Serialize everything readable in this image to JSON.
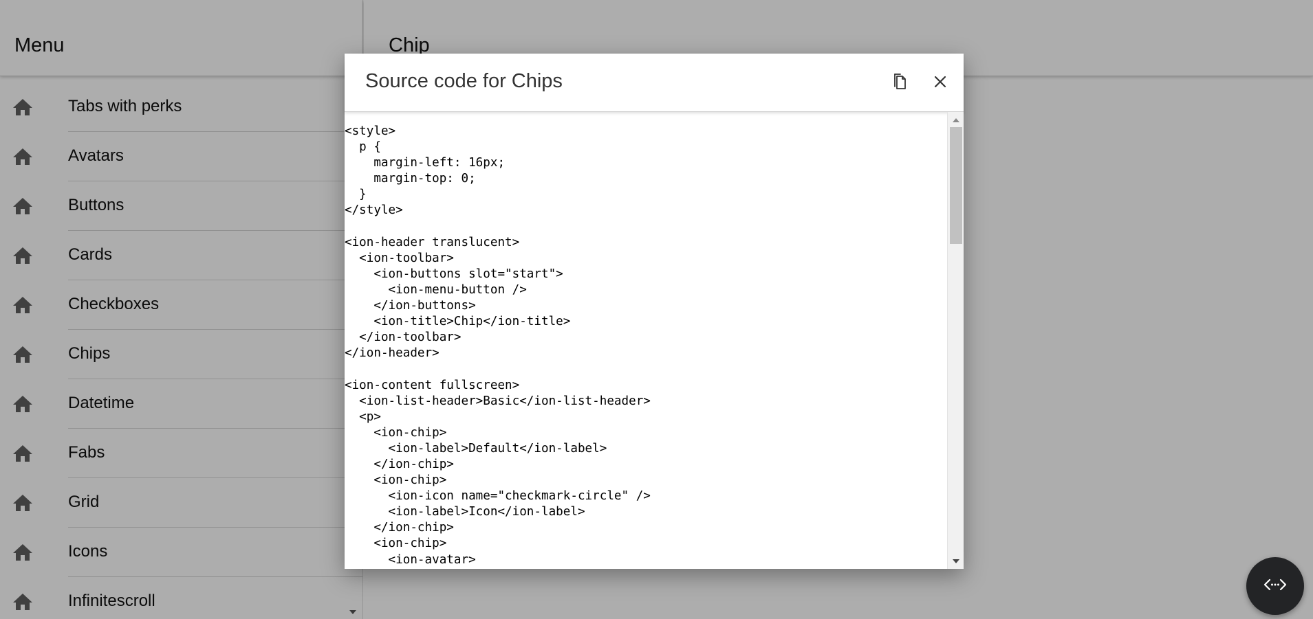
{
  "menu": {
    "title": "Menu",
    "items": [
      {
        "label": "Tabs with perks",
        "icon": "home-icon"
      },
      {
        "label": "Avatars",
        "icon": "home-icon"
      },
      {
        "label": "Buttons",
        "icon": "home-icon"
      },
      {
        "label": "Cards",
        "icon": "home-icon"
      },
      {
        "label": "Checkboxes",
        "icon": "home-icon"
      },
      {
        "label": "Chips",
        "icon": "home-icon"
      },
      {
        "label": "Datetime",
        "icon": "home-icon"
      },
      {
        "label": "Fabs",
        "icon": "home-icon"
      },
      {
        "label": "Grid",
        "icon": "home-icon"
      },
      {
        "label": "Icons",
        "icon": "home-icon"
      },
      {
        "label": "Infinitescroll",
        "icon": "home-icon"
      }
    ]
  },
  "page": {
    "title": "Chip"
  },
  "modal": {
    "title": "Source code for Chips",
    "copy_icon": "copy-icon",
    "close_icon": "close-icon",
    "code_lines": [
      "<style>",
      "  p {",
      "    margin-left: 16px;",
      "    margin-top: 0;",
      "  }",
      "</style>",
      "",
      "<ion-header translucent>",
      "  <ion-toolbar>",
      "    <ion-buttons slot=\"start\">",
      "      <ion-menu-button />",
      "    </ion-buttons>",
      "    <ion-title>Chip</ion-title>",
      "  </ion-toolbar>",
      "</ion-header>",
      "",
      "<ion-content fullscreen>",
      "  <ion-list-header>Basic</ion-list-header>",
      "  <p>",
      "    <ion-chip>",
      "      <ion-label>Default</ion-label>",
      "    </ion-chip>",
      "    <ion-chip>",
      "      <ion-icon name=\"checkmark-circle\" />",
      "      <ion-label>Icon</ion-label>",
      "    </ion-chip>",
      "    <ion-chip>",
      "      <ion-avatar>"
    ]
  },
  "fab": {
    "icon": "code-icon"
  },
  "colors": {
    "backdrop": "rgba(0,0,0,0.32)",
    "fab": "#232426",
    "menu_icon": "#5f5f5f"
  }
}
